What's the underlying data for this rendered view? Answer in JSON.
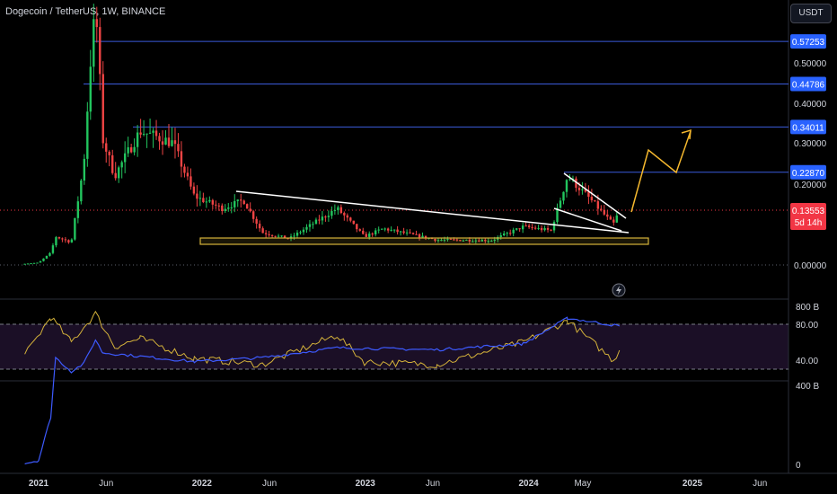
{
  "title": "Dogecoin / TetherUS, 1W, BINANCE",
  "currency_button": "USDT",
  "countdown": "5d 14h",
  "colors": {
    "background": "#000000",
    "up": "#22c55e",
    "down": "#ef4444",
    "level_line": "#3b5bdb",
    "level_label_bg": "#2962ff",
    "price_label_bg": "#f23645",
    "rsi_line": "#d4b23a",
    "rsi_band": "#1b0f26",
    "volume_line": "#3d5afe",
    "forecast_arrow": "#f5b82e",
    "zone_border": "#d4b23a",
    "trendline": "#ffffff"
  },
  "chart_data": [
    {
      "type": "candlestick",
      "series_description": "Dogecoin / TetherUS weekly candles",
      "x_ticks": [
        "2021",
        "Jun",
        "2022",
        "Jun",
        "2023",
        "Jun",
        "2024",
        "May",
        "2025",
        "Jun"
      ],
      "y_ticks": [
        "0.50000",
        "0.40000",
        "0.30000",
        "0.20000",
        "0.00000"
      ],
      "y_scale": "log",
      "level_labels": [
        "0.57253",
        "0.44786",
        "0.34011",
        "0.22870"
      ],
      "last_price": "0.13553",
      "approx_close_path": [
        {
          "date": "2020-12-01",
          "close": 0.003
        },
        {
          "date": "2021-01-01",
          "close": 0.0057
        },
        {
          "date": "2021-01-28",
          "close": 0.03
        },
        {
          "date": "2021-02-08",
          "close": 0.07
        },
        {
          "date": "2021-03-15",
          "close": 0.056
        },
        {
          "date": "2021-04-12",
          "close": 0.25
        },
        {
          "date": "2021-05-08",
          "close": 0.69
        },
        {
          "date": "2021-05-24",
          "close": 0.31
        },
        {
          "date": "2021-06-20",
          "close": 0.22
        },
        {
          "date": "2021-08-16",
          "close": 0.33
        },
        {
          "date": "2021-10-28",
          "close": 0.3
        },
        {
          "date": "2021-12-15",
          "close": 0.17
        },
        {
          "date": "2022-02-15",
          "close": 0.14
        },
        {
          "date": "2022-04-04",
          "close": 0.16
        },
        {
          "date": "2022-05-16",
          "close": 0.08
        },
        {
          "date": "2022-07-15",
          "close": 0.065
        },
        {
          "date": "2022-10-30",
          "close": 0.14
        },
        {
          "date": "2022-12-30",
          "close": 0.07
        },
        {
          "date": "2023-02-10",
          "close": 0.09
        },
        {
          "date": "2023-06-10",
          "close": 0.062
        },
        {
          "date": "2023-10-10",
          "close": 0.061
        },
        {
          "date": "2023-12-20",
          "close": 0.095
        },
        {
          "date": "2024-02-20",
          "close": 0.085
        },
        {
          "date": "2024-03-28",
          "close": 0.22
        },
        {
          "date": "2024-05-20",
          "close": 0.16
        },
        {
          "date": "2024-07-08",
          "close": 0.1
        },
        {
          "date": "2024-07-22",
          "close": 0.13553
        }
      ]
    },
    {
      "type": "line",
      "series_description": "RSI",
      "y_ticks": [
        "80.00",
        "40.00"
      ],
      "bands": [
        80,
        30
      ],
      "approx_values": [
        {
          "date": "2020-12-01",
          "value": 45
        },
        {
          "date": "2021-01-28",
          "value": 88
        },
        {
          "date": "2021-03-15",
          "value": 60
        },
        {
          "date": "2021-05-08",
          "value": 92
        },
        {
          "date": "2021-06-20",
          "value": 55
        },
        {
          "date": "2021-08-16",
          "value": 64
        },
        {
          "date": "2021-12-15",
          "value": 42
        },
        {
          "date": "2022-05-16",
          "value": 35
        },
        {
          "date": "2022-10-30",
          "value": 68
        },
        {
          "date": "2022-12-30",
          "value": 38
        },
        {
          "date": "2023-06-10",
          "value": 35
        },
        {
          "date": "2023-12-20",
          "value": 60
        },
        {
          "date": "2024-03-28",
          "value": 84
        },
        {
          "date": "2024-07-08",
          "value": 40
        },
        {
          "date": "2024-07-22",
          "value": 51
        }
      ]
    },
    {
      "type": "line",
      "series_description": "Volume-based indicator",
      "y_ticks": [
        "800 B",
        "400 B",
        "0"
      ],
      "approx_values": [
        {
          "date": "2020-12-01",
          "value": 5
        },
        {
          "date": "2021-01-01",
          "value": 20
        },
        {
          "date": "2021-01-28",
          "value": 240
        },
        {
          "date": "2021-02-08",
          "value": 540
        },
        {
          "date": "2021-03-15",
          "value": 470
        },
        {
          "date": "2021-04-12",
          "value": 510
        },
        {
          "date": "2021-05-08",
          "value": 630
        },
        {
          "date": "2021-05-24",
          "value": 565
        },
        {
          "date": "2021-12-15",
          "value": 520
        },
        {
          "date": "2022-05-16",
          "value": 540
        },
        {
          "date": "2022-10-30",
          "value": 590
        },
        {
          "date": "2023-06-10",
          "value": 580
        },
        {
          "date": "2023-12-20",
          "value": 610
        },
        {
          "date": "2024-03-28",
          "value": 740
        },
        {
          "date": "2024-07-22",
          "value": 700
        }
      ]
    }
  ]
}
